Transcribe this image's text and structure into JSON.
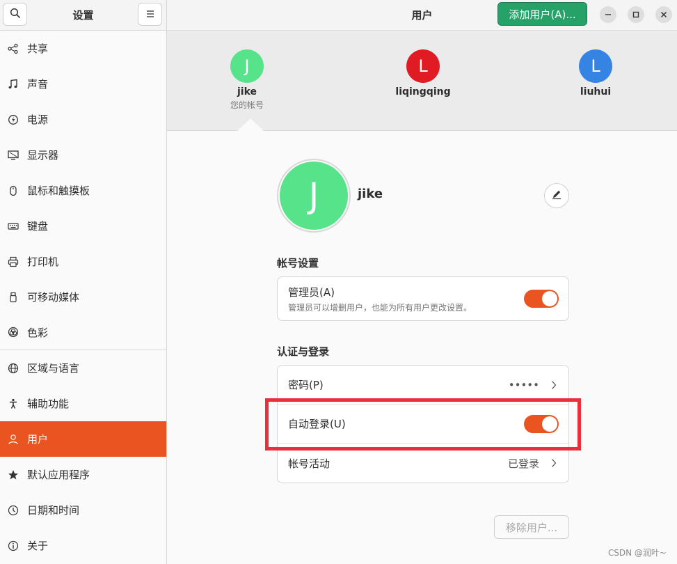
{
  "sidebar": {
    "title": "设置",
    "items": [
      {
        "label": "共享",
        "icon": "share-icon"
      },
      {
        "label": "声音",
        "icon": "music-note-icon"
      },
      {
        "label": "电源",
        "icon": "power-icon"
      },
      {
        "label": "显示器",
        "icon": "display-icon"
      },
      {
        "label": "鼠标和触摸板",
        "icon": "mouse-icon"
      },
      {
        "label": "键盘",
        "icon": "keyboard-icon"
      },
      {
        "label": "打印机",
        "icon": "printer-icon"
      },
      {
        "label": "可移动媒体",
        "icon": "usb-drive-icon"
      },
      {
        "label": "色彩",
        "icon": "color-icon"
      },
      {
        "label": "区域与语言",
        "icon": "globe-icon"
      },
      {
        "label": "辅助功能",
        "icon": "accessibility-icon"
      },
      {
        "label": "用户",
        "icon": "user-icon"
      },
      {
        "label": "默认应用程序",
        "icon": "star-icon"
      },
      {
        "label": "日期和时间",
        "icon": "clock-icon"
      },
      {
        "label": "关于",
        "icon": "info-icon"
      }
    ],
    "active_label": "用户"
  },
  "header": {
    "title": "用户",
    "add_user_label": "添加用户(A)..."
  },
  "users": [
    {
      "initial": "J",
      "name": "jike",
      "subtitle": "您的帐号",
      "color": "#57e389"
    },
    {
      "initial": "L",
      "name": "liqingqing",
      "subtitle": "",
      "color": "#e01b24"
    },
    {
      "initial": "L",
      "name": "liuhui",
      "subtitle": "",
      "color": "#3584e4"
    }
  ],
  "profile": {
    "initial": "J",
    "name": "jike",
    "avatar_color": "#57e389"
  },
  "account_settings": {
    "title": "帐号设置",
    "admin_label": "管理员(A)",
    "admin_desc": "管理员可以增删用户，也能为所有用户更改设置。",
    "admin_enabled": true
  },
  "auth": {
    "title": "认证与登录",
    "password_label": "密码(P)",
    "password_value": "•••••",
    "autologin_label": "自动登录(U)",
    "autologin_enabled": true,
    "activity_label": "帐号活动",
    "activity_value": "已登录"
  },
  "remove_user_label": "移除用户...",
  "watermark": "CSDN @润叶~",
  "colors": {
    "accent": "#e95420",
    "add_button": "#26a269",
    "highlight_box": "#e8303a"
  }
}
